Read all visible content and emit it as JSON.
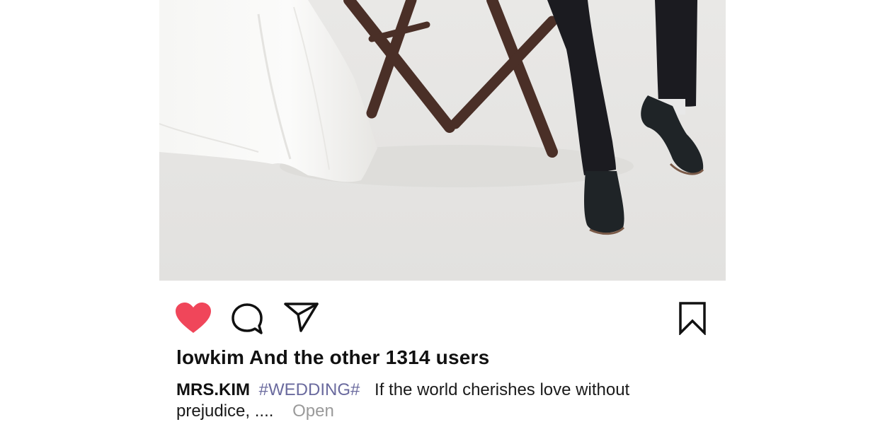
{
  "post": {
    "image_alt": "Bride in white gown and groom in black suit and leather shoes seated on wooden folding chairs",
    "actions": {
      "like_icon": "heart-filled-icon",
      "comment_icon": "speech-bubble-icon",
      "share_icon": "paper-plane-icon",
      "save_icon": "bookmark-icon"
    },
    "likes_text": "lowkim And the other 1314 users",
    "caption": {
      "username": "MRS.KIM",
      "hashtag": "#WEDDING#",
      "text": "If the world cherishes love without prejudice, ....",
      "more_label": "Open"
    }
  },
  "colors": {
    "like_red": "#f0465a",
    "hashtag": "#6a6a9e",
    "muted": "#9a9a9a",
    "backdrop": "#e6e5e3"
  }
}
